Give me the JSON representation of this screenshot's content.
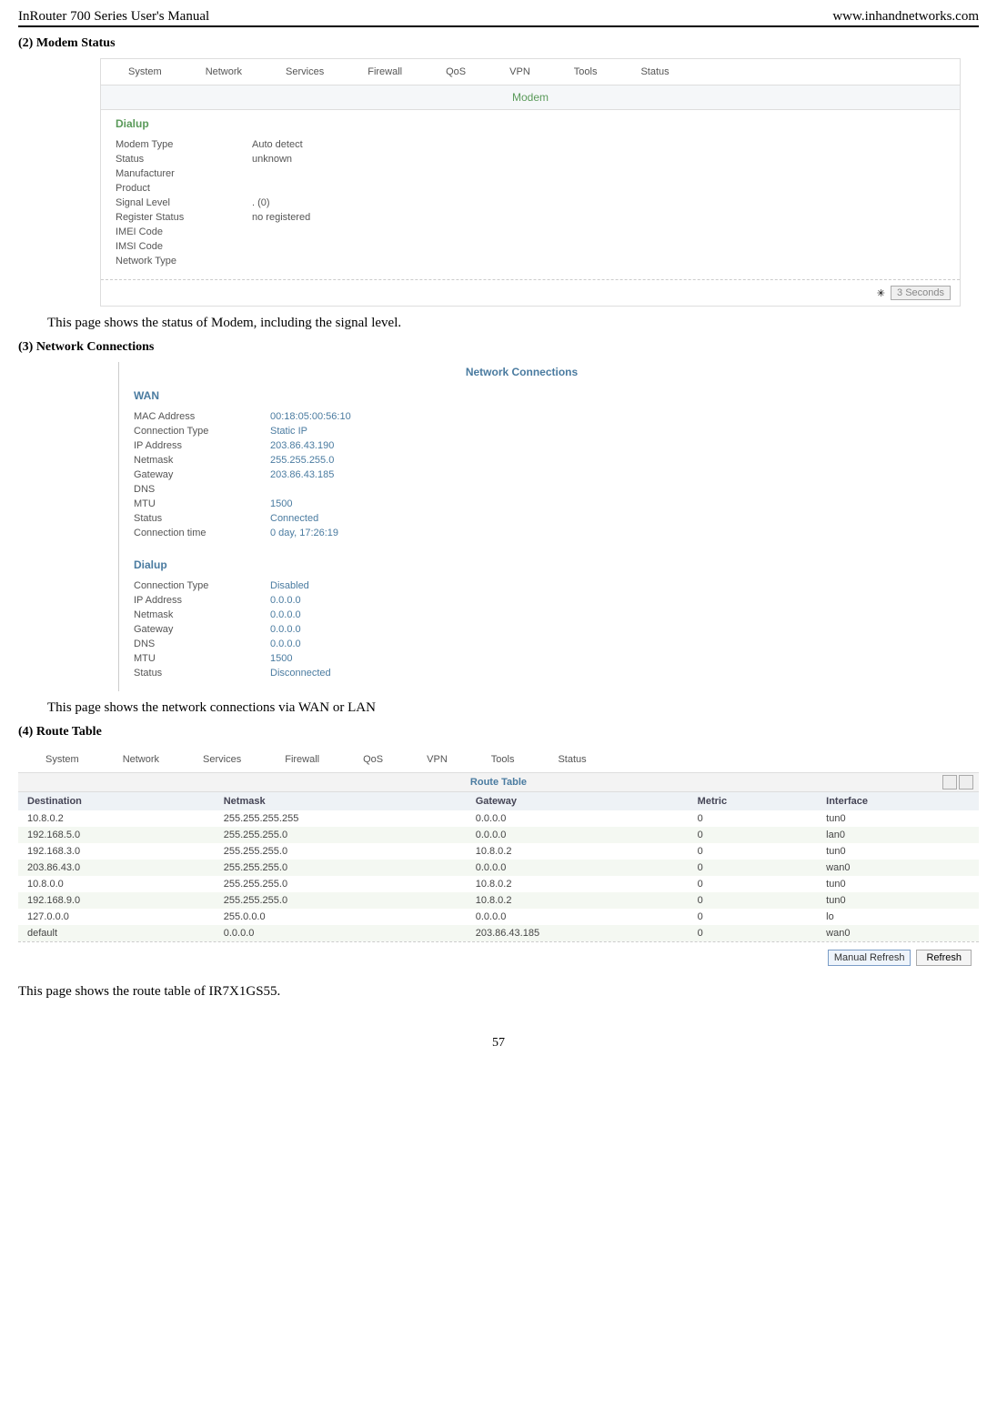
{
  "header": {
    "left": "InRouter 700 Series User's Manual",
    "right": "www.inhandnetworks.com"
  },
  "s2": {
    "heading": "(2)   Modem Status",
    "nav": [
      "System",
      "Network",
      "Services",
      "Firewall",
      "QoS",
      "VPN",
      "Tools",
      "Status"
    ],
    "title": "Modem",
    "section": "Dialup",
    "rows": [
      {
        "k": "Modem Type",
        "v": "Auto detect"
      },
      {
        "k": "Status",
        "v": "unknown"
      },
      {
        "k": "Manufacturer",
        "v": ""
      },
      {
        "k": "Product",
        "v": ""
      },
      {
        "k": "Signal Level",
        "v": ". (0)"
      },
      {
        "k": "Register Status",
        "v": "no registered"
      },
      {
        "k": "IMEI Code",
        "v": ""
      },
      {
        "k": "IMSI Code",
        "v": ""
      },
      {
        "k": "Network Type",
        "v": ""
      }
    ],
    "refresh": "3 Seconds",
    "body": "This page shows the status of Modem, including the signal level."
  },
  "s3": {
    "heading": "(3)   Network Connections",
    "title": "Network Connections",
    "wan_label": "WAN",
    "wan_rows": [
      {
        "k": "MAC Address",
        "v": "00:18:05:00:56:10"
      },
      {
        "k": "Connection Type",
        "v": "Static IP"
      },
      {
        "k": "IP Address",
        "v": "203.86.43.190"
      },
      {
        "k": "Netmask",
        "v": "255.255.255.0"
      },
      {
        "k": "Gateway",
        "v": "203.86.43.185"
      },
      {
        "k": "DNS",
        "v": ""
      },
      {
        "k": "MTU",
        "v": "1500"
      },
      {
        "k": "Status",
        "v": "Connected"
      },
      {
        "k": "Connection time",
        "v": "0 day, 17:26:19"
      }
    ],
    "dialup_label": "Dialup",
    "dialup_rows": [
      {
        "k": "Connection Type",
        "v": "Disabled"
      },
      {
        "k": "IP Address",
        "v": "0.0.0.0"
      },
      {
        "k": "Netmask",
        "v": "0.0.0.0"
      },
      {
        "k": "Gateway",
        "v": "0.0.0.0"
      },
      {
        "k": "DNS",
        "v": "0.0.0.0"
      },
      {
        "k": "MTU",
        "v": "1500"
      },
      {
        "k": "Status",
        "v": "Disconnected"
      }
    ],
    "body": "This page shows the network connections via WAN or LAN"
  },
  "s4": {
    "heading": "(4)   Route Table",
    "nav": [
      "System",
      "Network",
      "Services",
      "Firewall",
      "QoS",
      "VPN",
      "Tools",
      "Status"
    ],
    "title": "Route Table",
    "columns": [
      "Destination",
      "Netmask",
      "Gateway",
      "Metric",
      "Interface"
    ],
    "rows": [
      [
        "10.8.0.2",
        "255.255.255.255",
        "0.0.0.0",
        "0",
        "tun0"
      ],
      [
        "192.168.5.0",
        "255.255.255.0",
        "0.0.0.0",
        "0",
        "lan0"
      ],
      [
        "192.168.3.0",
        "255.255.255.0",
        "10.8.0.2",
        "0",
        "tun0"
      ],
      [
        "203.86.43.0",
        "255.255.255.0",
        "0.0.0.0",
        "0",
        "wan0"
      ],
      [
        "10.8.0.0",
        "255.255.255.0",
        "10.8.0.2",
        "0",
        "tun0"
      ],
      [
        "192.168.9.0",
        "255.255.255.0",
        "10.8.0.2",
        "0",
        "tun0"
      ],
      [
        "127.0.0.0",
        "255.0.0.0",
        "0.0.0.0",
        "0",
        "lo"
      ],
      [
        "default",
        "0.0.0.0",
        "203.86.43.185",
        "0",
        "wan0"
      ]
    ],
    "refresh_select": "Manual Refresh",
    "refresh_btn": "Refresh",
    "body": "This page shows the route table of IR7X1GS55."
  },
  "page_num": "57"
}
